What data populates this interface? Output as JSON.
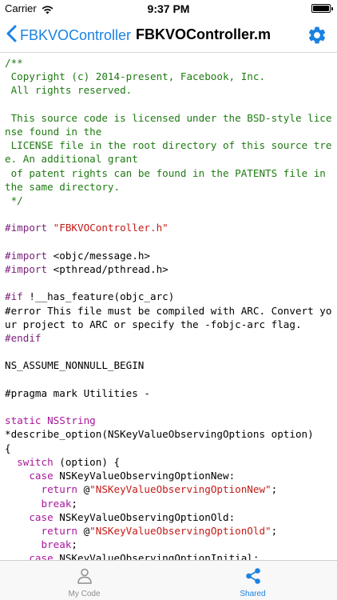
{
  "status_bar": {
    "carrier": "Carrier",
    "time": "9:37 PM",
    "battery_level": 1.0
  },
  "nav": {
    "back_label": "FBKVOController",
    "title": "FBKVOController.m",
    "settings_icon": "gear-icon",
    "accent_color": "#1a82e2"
  },
  "code": {
    "language": "Objective-C",
    "lines": [
      [
        {
          "t": "/**",
          "c": "comment"
        }
      ],
      [
        {
          "t": " Copyright (c) 2014-present, Facebook, Inc.",
          "c": "comment"
        }
      ],
      [
        {
          "t": " All rights reserved.",
          "c": "comment"
        }
      ],
      [
        {
          "t": "",
          "c": ""
        }
      ],
      [
        {
          "t": " This source code is licensed under the BSD-style license found in the",
          "c": "comment"
        }
      ],
      [
        {
          "t": " LICENSE file in the root directory of this source tree. An additional grant",
          "c": "comment"
        }
      ],
      [
        {
          "t": " of patent rights can be found in the PATENTS file in the same directory.",
          "c": "comment"
        }
      ],
      [
        {
          "t": " */",
          "c": "comment"
        }
      ],
      [
        {
          "t": "",
          "c": ""
        }
      ],
      [
        {
          "t": "#import ",
          "c": "pp"
        },
        {
          "t": "\"FBKVOController.h\"",
          "c": "str"
        }
      ],
      [
        {
          "t": "",
          "c": ""
        }
      ],
      [
        {
          "t": "#import ",
          "c": "pp"
        },
        {
          "t": "<objc/message.h>",
          "c": ""
        }
      ],
      [
        {
          "t": "#import ",
          "c": "pp"
        },
        {
          "t": "<pthread/pthread.h>",
          "c": ""
        }
      ],
      [
        {
          "t": "",
          "c": ""
        }
      ],
      [
        {
          "t": "#if ",
          "c": "pp"
        },
        {
          "t": "!__has_feature(objc_arc)",
          "c": ""
        }
      ],
      [
        {
          "t": "#error This file must be compiled with ARC. Convert your project to ARC or specify the -fobjc-arc flag.",
          "c": ""
        }
      ],
      [
        {
          "t": "#endif",
          "c": "pp"
        }
      ],
      [
        {
          "t": "",
          "c": ""
        }
      ],
      [
        {
          "t": "NS_ASSUME_NONNULL_BEGIN",
          "c": ""
        }
      ],
      [
        {
          "t": "",
          "c": ""
        }
      ],
      [
        {
          "t": "#pragma mark Utilities -",
          "c": ""
        }
      ],
      [
        {
          "t": "",
          "c": ""
        }
      ],
      [
        {
          "t": "static NSString",
          "c": "kw"
        }
      ],
      [
        {
          "t": "*describe_option(NSKeyValueObservingOptions option)",
          "c": ""
        }
      ],
      [
        {
          "t": "{",
          "c": ""
        }
      ],
      [
        {
          "t": "  ",
          "c": ""
        },
        {
          "t": "switch",
          "c": "kw"
        },
        {
          "t": " (option) {",
          "c": ""
        }
      ],
      [
        {
          "t": "    ",
          "c": ""
        },
        {
          "t": "case",
          "c": "kw"
        },
        {
          "t": " NSKeyValueObservingOptionNew:",
          "c": ""
        }
      ],
      [
        {
          "t": "      ",
          "c": ""
        },
        {
          "t": "return",
          "c": "kw"
        },
        {
          "t": " @",
          "c": ""
        },
        {
          "t": "\"NSKeyValueObservingOptionNew\"",
          "c": "str"
        },
        {
          "t": ";",
          "c": ""
        }
      ],
      [
        {
          "t": "      ",
          "c": ""
        },
        {
          "t": "break",
          "c": "kw"
        },
        {
          "t": ";",
          "c": ""
        }
      ],
      [
        {
          "t": "    ",
          "c": ""
        },
        {
          "t": "case",
          "c": "kw"
        },
        {
          "t": " NSKeyValueObservingOptionOld:",
          "c": ""
        }
      ],
      [
        {
          "t": "      ",
          "c": ""
        },
        {
          "t": "return",
          "c": "kw"
        },
        {
          "t": " @",
          "c": ""
        },
        {
          "t": "\"NSKeyValueObservingOptionOld\"",
          "c": "str"
        },
        {
          "t": ";",
          "c": ""
        }
      ],
      [
        {
          "t": "      ",
          "c": ""
        },
        {
          "t": "break",
          "c": "kw"
        },
        {
          "t": ";",
          "c": ""
        }
      ],
      [
        {
          "t": "    ",
          "c": ""
        },
        {
          "t": "case",
          "c": "kw"
        },
        {
          "t": " NSKeyValueObservingOptionInitial:",
          "c": ""
        }
      ]
    ]
  },
  "tabs": [
    {
      "label": "My Code",
      "icon": "person-icon",
      "selected": false
    },
    {
      "label": "Shared",
      "icon": "share-icon",
      "selected": true
    }
  ]
}
